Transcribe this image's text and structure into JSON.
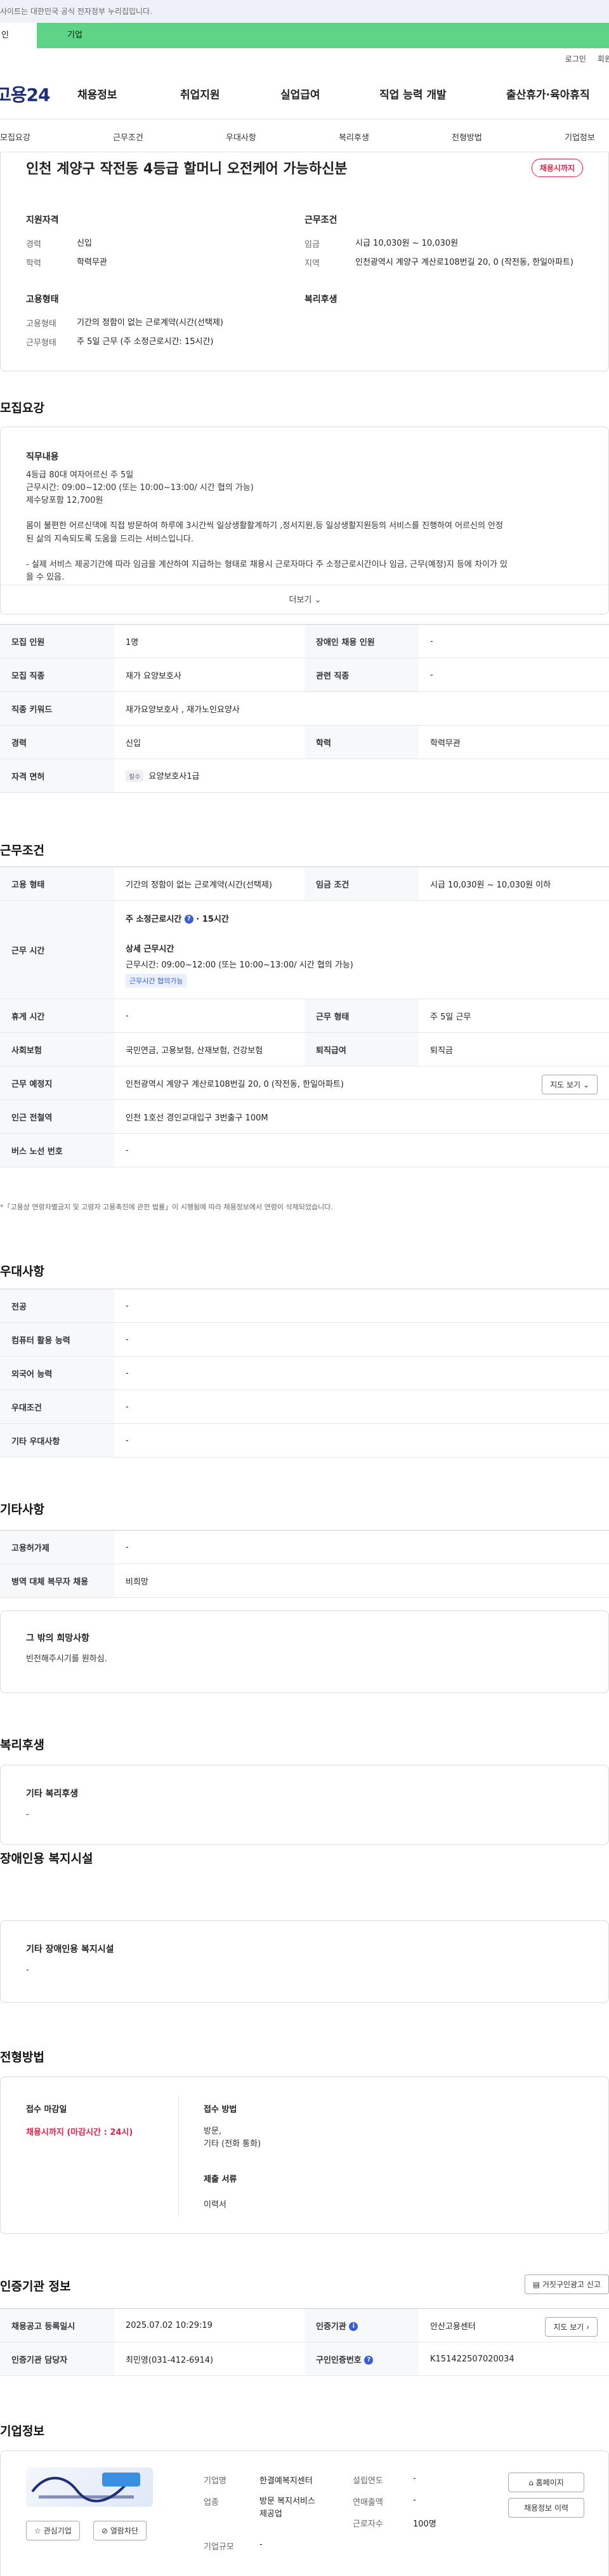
{
  "topbar": {
    "notice": "사이트는 대한민국 공식 전자정부 누리집입니다."
  },
  "segment": {
    "individual": "인",
    "business": "기업"
  },
  "util": {
    "login": "로그인",
    "join": "회원"
  },
  "gnb": {
    "logo": "고용24",
    "items": [
      "채용정보",
      "취업지원",
      "실업급여",
      "직업 능력 개발",
      "출산휴가·육아휴직"
    ]
  },
  "subnav": {
    "items": [
      "모집요강",
      "근무조건",
      "우대사항",
      "복리후생",
      "전형방법",
      "기업정보"
    ]
  },
  "job": {
    "title": "인천 계양구 작전동 4등급 할머니 오전케어 가능하신분",
    "status": "채용시까지",
    "qual_title": "지원자격",
    "qual": [
      {
        "k": "경력",
        "v": "신입"
      },
      {
        "k": "학력",
        "v": "학력무관"
      }
    ],
    "cond_title": "근무조건",
    "cond": [
      {
        "k": "임금",
        "v": "시급 10,030원 ~ 10,030원"
      },
      {
        "k": "지역",
        "v": "인천광역시 계양구 계산로108번길 20, 0 (작전동, 한일아파트)"
      }
    ],
    "emp_title": "고용형태",
    "emp": [
      {
        "k": "고용형태",
        "v": "기간의 정함이 없는 근로계약(시간(선택제)"
      },
      {
        "k": "근무형태",
        "v": "주 5일 근무 (주 소정근로시간: 15시간)"
      }
    ],
    "welfare_title": "복리후생"
  },
  "recruit": {
    "section": "모집요강",
    "duty_title": "직무내용",
    "duty_lines": [
      "4등급 80대 여자어르신 주 5일",
      "근무시간: 09:00~12:00 (또는 10:00~13:00/ 시간 협의 가능)",
      "제수당포함 12,700원",
      "",
      "몸이 불편한 어르신댁에 직접 방문하여 하루에 3시간씩 일상생활활계하기 ,정서지원,등 일상생활지원등의 서비스를 진행하여 어르신의 안정",
      "된 삶의 지속되도록 도움을 드리는 서비스입니다.",
      "",
      "- 실제 서비스 제공기간에 따라 임금을 계산하여 지급하는 형태로 채용시 근로자마다 주 소정근로시간이나 임금, 근무(예정)지 등에 차이가 있",
      "을 수 있음."
    ],
    "more": "더보기",
    "table": [
      {
        "k1": "모집 인원",
        "v1": "1명",
        "k2": "장애인 채용 인원",
        "v2": "-"
      },
      {
        "k1": "모집 직종",
        "v1": "재가 요양보호사",
        "k2": "관련 직종",
        "v2": "-"
      },
      {
        "k1": "직종 키워드",
        "v1": "재가요양보호사 , 재가노인요양사"
      },
      {
        "k1": "경력",
        "v1": "신입",
        "k2": "학력",
        "v2": "학력무관"
      },
      {
        "k1": "자격 면허",
        "chip": "필수",
        "v1": "요양보호사1급"
      }
    ]
  },
  "work": {
    "section": "근무조건",
    "emp_type_k": "고용 형태",
    "emp_type_v": "기간의 정함이 없는 근로계약(시간(선택제)",
    "wage_k": "임금 조건",
    "wage_v": "시급 10,030원 ~ 10,030원 이하",
    "hours_k": "근무 시간",
    "weekly_label": "주 소정근로시간",
    "weekly_value": "15시간",
    "detail_label": "상세 근무시간",
    "detail_value": "근무시간: 09:00~12:00 (또는 10:00~13:00/ 시간 협의 가능)",
    "detail_chip": "근무시간 협의가능",
    "rest_k": "휴게 시간",
    "rest_v": "-",
    "form_k": "근무 형태",
    "form_v": "주 5일 근무",
    "ins_k": "사회보험",
    "ins_v": "국민연금, 고용보험, 산재보험, 건강보험",
    "sev_k": "퇴직급여",
    "sev_v": "퇴직금",
    "place_k": "근무 예정지",
    "place_v": "인천광역시 계양구 계산로108번길 20, 0 (작전동, 한일아파트)",
    "map_btn": "지도 보기",
    "subway_k": "인근 전철역",
    "subway_v": "인천 1호선 경인교대입구 3번출구 100M",
    "bus_k": "버스 노선 번호",
    "bus_v": "-",
    "note": "*「고용상 연령차별금지 및 고령자 고용촉진에 관한 법률」이 시행됨에 따라 채용정보에서 연령이 삭제되었습니다."
  },
  "pref": {
    "section": "우대사항",
    "rows": [
      {
        "k": "전공",
        "v": "-"
      },
      {
        "k": "컴퓨터 활용 능력",
        "v": "-"
      },
      {
        "k": "외국어 능력",
        "v": "-"
      },
      {
        "k": "우대조건",
        "v": "-"
      },
      {
        "k": "기타 우대사항",
        "v": "-"
      }
    ]
  },
  "etc": {
    "section": "기타사항",
    "rows": [
      {
        "k": "고용허가제",
        "v": "-"
      },
      {
        "k": "병역 대체 복무자 채용",
        "v": "비희망"
      }
    ],
    "hope_title": "그 밖의 희망사항",
    "hope_text": "빈전해주시기를 원하심."
  },
  "welfare": {
    "section": "복리후생",
    "title": "기타 복리후생",
    "value": "-"
  },
  "disability": {
    "section": "장애인용 복지시설",
    "title": "기타 장애인용 복지시설",
    "value": "-"
  },
  "screening": {
    "section": "전형방법",
    "deadline_label": "접수 마감일",
    "deadline_value": "채용시까지 (마감시간 : 24시)",
    "method_label": "접수 방법",
    "method_value1": "방문,",
    "method_value2": "기타 (전화 통화)",
    "docs_label": "제출 서류",
    "docs_value": "이력서"
  },
  "agency": {
    "section": "인증기관 정보",
    "report_btn": "거짓구인광고 신고",
    "reg_k": "채용공고 등록일시",
    "reg_v": "2025.07.02 10:29:19",
    "org_k": "인증기관",
    "org_v": "안산고용센터",
    "map_btn": "지도 보기",
    "mgr_k": "인증기관 담당자",
    "mgr_v": "최민영(031-412-6914)",
    "num_k": "구인인증번호",
    "num_v": "K151422507020034"
  },
  "company": {
    "section": "기업정보",
    "fav_btn": "관심기업",
    "block_btn": "열람차단",
    "name_k": "기업명",
    "name_v": "한결예복지센터",
    "found_k": "설립연도",
    "found_v": "-",
    "ind_k": "업종",
    "ind_v1": "방문 복지서비스",
    "ind_v2": "제공업",
    "sales_k": "연매출액",
    "sales_v": "-",
    "emp_k": "근로자수",
    "emp_v": "100명",
    "size_k": "기업규모",
    "size_v": "-",
    "home_btn": "홈페이지",
    "jobs_btn": "채용정보 이력"
  },
  "colors": {
    "brand": "#1e2f7a",
    "business_bar": "#5fd486",
    "accent_red": "#d9264a",
    "accent_blue": "#3b5bdb"
  }
}
